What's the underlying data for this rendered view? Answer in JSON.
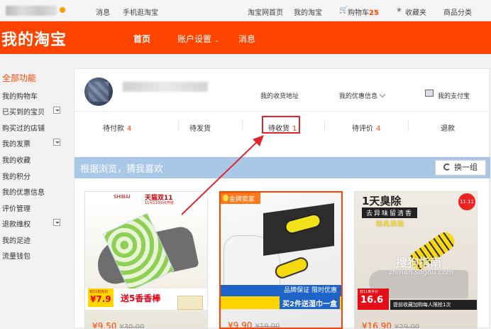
{
  "topbar": {
    "messages": "消息",
    "mobile": "手机逛淘宝",
    "home": "淘宝网首页",
    "my_taobao": "我的淘宝",
    "cart": "购物车",
    "cart_count": "25",
    "favorites": "收藏夹",
    "categories": "商品分类"
  },
  "header": {
    "logo": "我的淘宝",
    "nav": [
      "首页",
      "账户设置",
      "消息"
    ]
  },
  "sidebar": {
    "title": "全部功能",
    "items": [
      "我的购物车",
      "已买到的宝贝",
      "购买过的店铺",
      "我的发票",
      "我的收藏",
      "我的积分",
      "我的优惠信息",
      "评价管理",
      "退款维权",
      "我的足迹",
      "流量钱包"
    ]
  },
  "account": {
    "address": "我的收货地址",
    "coupons": "我的优惠信息",
    "alipay": "我的支付宝"
  },
  "orders": [
    {
      "label": "待付款",
      "count": "4"
    },
    {
      "label": "待发货",
      "count": ""
    },
    {
      "label": "待收货",
      "count": "1"
    },
    {
      "label": "待评价",
      "count": "4"
    },
    {
      "label": "退款",
      "count": ""
    }
  ],
  "recommend": {
    "title": "根据浏览，猜我喜欢",
    "refresh": "换一组"
  },
  "products": [
    {
      "brand": "SHIBAI",
      "store": "天猫双11",
      "date": "11月11日0点开抢",
      "tag_top": "双11抢先价",
      "price_big": "¥7.9",
      "send": "送5香香棒",
      "price_partial": "¥9.50",
      "old_partial": "¥30.00"
    },
    {
      "gold_seller": "金牌卖家",
      "guarantee": "品牌保证 限时优惠",
      "lead": "买2件送湿巾一盒",
      "price_partial": "¥9.90",
      "old_partial": "¥19.00"
    },
    {
      "line1": "1天臭除",
      "line2": "去异味留清香",
      "line3": "除臭烘鞋",
      "badge": "11.11",
      "tag_top": "双11到手价",
      "price_big": "16.6",
      "promo": "提前收藏加购每人限抢1次",
      "price_partial": "¥16.90",
      "old_partial": "¥29.00"
    }
  ],
  "watermark": {
    "main": "搜狗指南",
    "sub": "zhinan.sogou.com"
  },
  "colors": {
    "brand": "#ff4400",
    "highlight": "#e0262c",
    "recommend_bar": "#a9c8e8"
  }
}
